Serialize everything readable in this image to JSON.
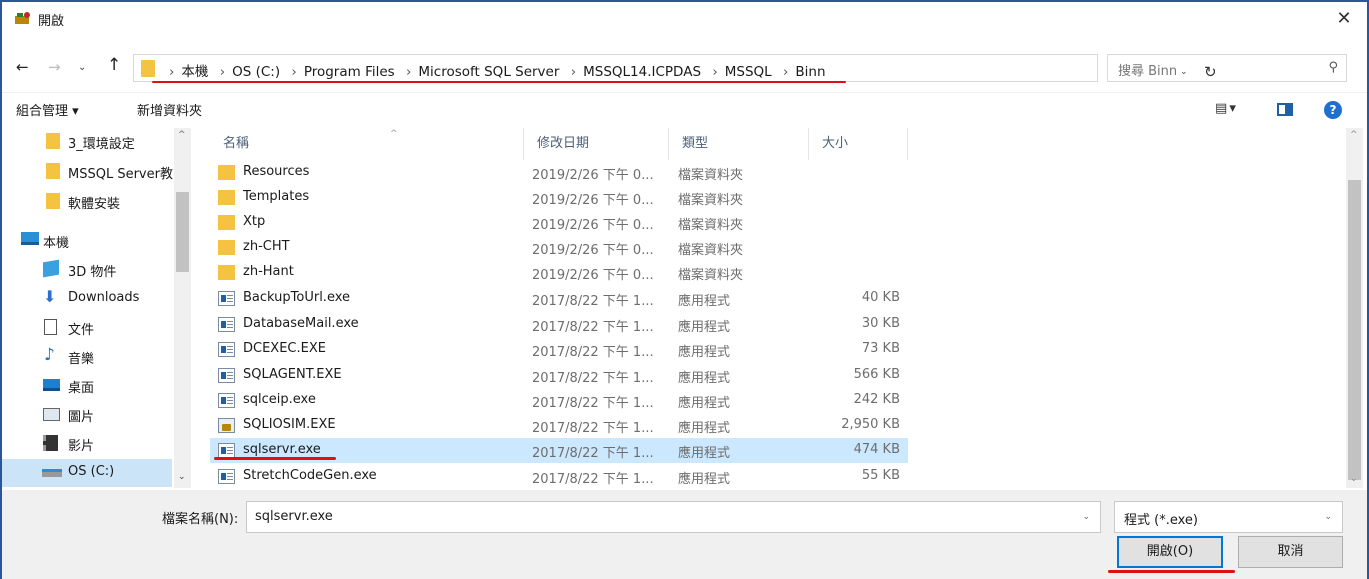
{
  "window": {
    "title": "開啟",
    "close_glyph": "✕"
  },
  "nav": {
    "back_glyph": "←",
    "forward_glyph": "→",
    "history_glyph": "⌄",
    "up_glyph": "↑",
    "breadcrumb": [
      "本機",
      "OS (C:)",
      "Program Files",
      "Microsoft SQL Server",
      "MSSQL14.ICPDAS",
      "MSSQL",
      "Binn"
    ],
    "crumb_separator": "›",
    "dropdown_glyph": "⌄",
    "refresh_glyph": "↻",
    "search_placeholder": "搜尋 Binn",
    "search_glyph": "⚲"
  },
  "toolbar": {
    "organize_label": "組合管理 ▾",
    "new_folder_label": "新增資料夾",
    "view_glyph": "▤ ▾",
    "help_label": "?"
  },
  "navpane": {
    "items": [
      {
        "label": "3_環境設定",
        "icon": "folder-icon"
      },
      {
        "label": "MSSQL Server教",
        "icon": "folder-icon"
      },
      {
        "label": "軟體安裝",
        "icon": "folder-icon"
      },
      {
        "label": "本機",
        "icon": "computer-icon"
      },
      {
        "label": "3D 物件",
        "icon": "3d-objects-icon"
      },
      {
        "label": "Downloads",
        "icon": "downloads-icon"
      },
      {
        "label": "文件",
        "icon": "documents-icon"
      },
      {
        "label": "音樂",
        "icon": "music-icon"
      },
      {
        "label": "桌面",
        "icon": "desktop-icon"
      },
      {
        "label": "圖片",
        "icon": "pictures-icon"
      },
      {
        "label": "影片",
        "icon": "videos-icon"
      },
      {
        "label": "OS (C:)",
        "icon": "drive-icon"
      }
    ],
    "scroll_up_glyph": "^",
    "scroll_down_glyph": "⌄"
  },
  "filelist": {
    "columns": [
      "名稱",
      "修改日期",
      "類型",
      "大小"
    ],
    "sort_glyph": "^",
    "rows": [
      {
        "name": "Resources",
        "date": "2019/2/26 下午 0...",
        "type": "檔案資料夾",
        "size": "",
        "icon": "folder-icon"
      },
      {
        "name": "Templates",
        "date": "2019/2/26 下午 0...",
        "type": "檔案資料夾",
        "size": "",
        "icon": "folder-icon"
      },
      {
        "name": "Xtp",
        "date": "2019/2/26 下午 0...",
        "type": "檔案資料夾",
        "size": "",
        "icon": "folder-icon"
      },
      {
        "name": "zh-CHT",
        "date": "2019/2/26 下午 0...",
        "type": "檔案資料夾",
        "size": "",
        "icon": "folder-icon"
      },
      {
        "name": "zh-Hant",
        "date": "2019/2/26 下午 0...",
        "type": "檔案資料夾",
        "size": "",
        "icon": "folder-icon"
      },
      {
        "name": "BackupToUrl.exe",
        "date": "2017/8/22 下午 1...",
        "type": "應用程式",
        "size": "40 KB",
        "icon": "exe-icon"
      },
      {
        "name": "DatabaseMail.exe",
        "date": "2017/8/22 下午 1...",
        "type": "應用程式",
        "size": "30 KB",
        "icon": "exe-icon"
      },
      {
        "name": "DCEXEC.EXE",
        "date": "2017/8/22 下午 1...",
        "type": "應用程式",
        "size": "73 KB",
        "icon": "exe-icon"
      },
      {
        "name": "SQLAGENT.EXE",
        "date": "2017/8/22 下午 1...",
        "type": "應用程式",
        "size": "566 KB",
        "icon": "exe-icon"
      },
      {
        "name": "sqlceip.exe",
        "date": "2017/8/22 下午 1...",
        "type": "應用程式",
        "size": "242 KB",
        "icon": "exe-icon"
      },
      {
        "name": "SQLIOSIM.EXE",
        "date": "2017/8/22 下午 1...",
        "type": "應用程式",
        "size": "2,950 KB",
        "icon": "sqliosim-icon"
      },
      {
        "name": "sqlservr.exe",
        "date": "2017/8/22 下午 1...",
        "type": "應用程式",
        "size": "474 KB",
        "icon": "exe-icon",
        "selected": true
      },
      {
        "name": "StretchCodeGen.exe",
        "date": "2017/8/22 下午 1...",
        "type": "應用程式",
        "size": "55 KB",
        "icon": "exe-icon"
      }
    ],
    "scroll_up_glyph": "^",
    "scroll_down_glyph": "⌄"
  },
  "bottom": {
    "filename_label": "檔案名稱(N):",
    "filename_value": "sqlservr.exe",
    "filetype_value": "程式 (*.exe)",
    "dropdown_glyph": "⌄",
    "open_label": "開啟(O)",
    "cancel_label": "取消"
  },
  "colors": {
    "accent": "#0078d7",
    "annotation_red": "#e01010",
    "folder": "#f5c342",
    "selection": "#cce8ff"
  }
}
